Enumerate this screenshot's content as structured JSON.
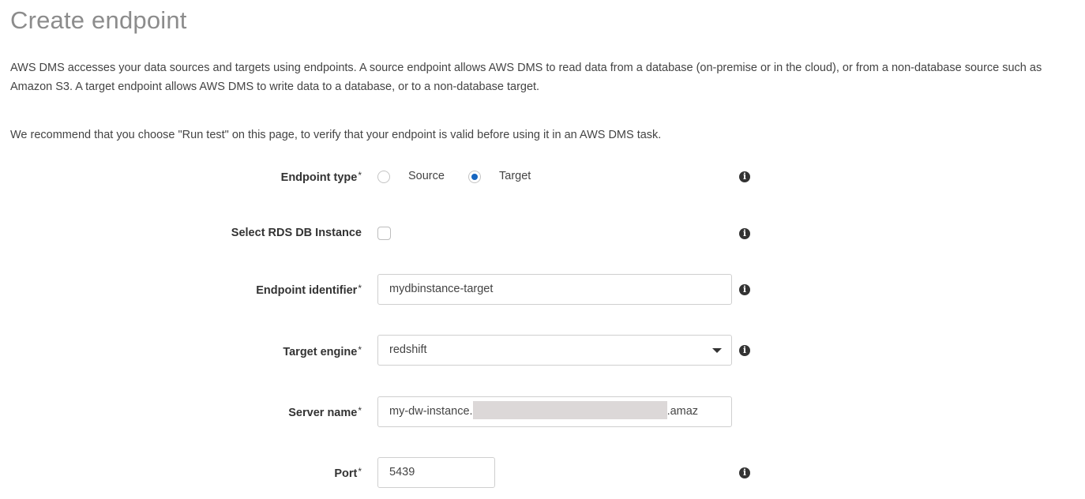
{
  "page": {
    "title": "Create endpoint",
    "description": "AWS DMS accesses your data sources and targets using endpoints. A source endpoint allows AWS DMS to read data from a database (on-premise or in the cloud), or from a non-database source such as Amazon S3. A target endpoint allows AWS DMS to write data to a database, or to a non-database target.",
    "recommendation": "We recommend that you choose \"Run test\" on this page, to verify that your endpoint is valid before using it in an AWS DMS task."
  },
  "form": {
    "endpoint_type": {
      "label": "Endpoint type",
      "required_mark": "*",
      "options": [
        {
          "label": "Source",
          "selected": false
        },
        {
          "label": "Target",
          "selected": true
        }
      ],
      "info_icon": "info-icon"
    },
    "select_rds": {
      "label": "Select RDS DB Instance",
      "checked": false,
      "info_icon": "info-icon"
    },
    "endpoint_identifier": {
      "label": "Endpoint identifier",
      "required_mark": "*",
      "value": "mydbinstance-target",
      "info_icon": "info-icon"
    },
    "target_engine": {
      "label": "Target engine",
      "required_mark": "*",
      "value": "redshift",
      "info_icon": "info-icon"
    },
    "server_name": {
      "label": "Server name",
      "required_mark": "*",
      "value_prefix": "my-dw-instance.",
      "value_suffix": ".amaz"
    },
    "port": {
      "label": "Port",
      "required_mark": "*",
      "value": "5439",
      "info_icon": "info-icon"
    }
  },
  "colors": {
    "accent": "#1565c0",
    "title": "#8c8c8c",
    "text": "#444444"
  }
}
